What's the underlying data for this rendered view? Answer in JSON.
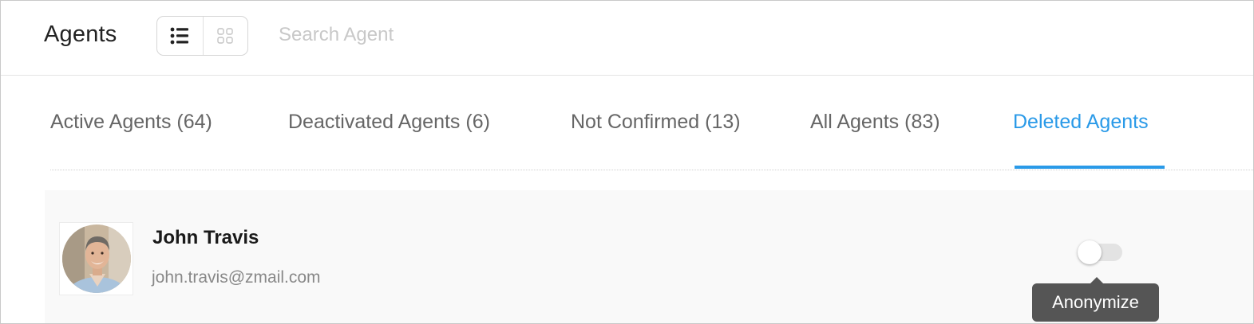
{
  "header": {
    "title": "Agents",
    "view_toggle": {
      "list_icon": "list-icon",
      "grid_icon": "grid-icon",
      "selected": "list"
    },
    "search": {
      "placeholder": "Search Agent",
      "value": ""
    }
  },
  "tabs": [
    {
      "label": "Active Agents (64)",
      "active": false
    },
    {
      "label": "Deactivated Agents (6)",
      "active": false
    },
    {
      "label": "Not Confirmed (13)",
      "active": false
    },
    {
      "label": "All Agents (83)",
      "active": false
    },
    {
      "label": "Deleted Agents",
      "active": true
    }
  ],
  "agent": {
    "name": "John Travis",
    "email": "john.travis@zmail.com",
    "avatar_icon": "avatar-photo",
    "anonymize_toggle_on": false
  },
  "tooltip": {
    "text": "Anonymize"
  },
  "colors": {
    "accent": "#2a9ae8",
    "tooltip_bg": "#555555",
    "row_bg": "#f9f9f9"
  }
}
